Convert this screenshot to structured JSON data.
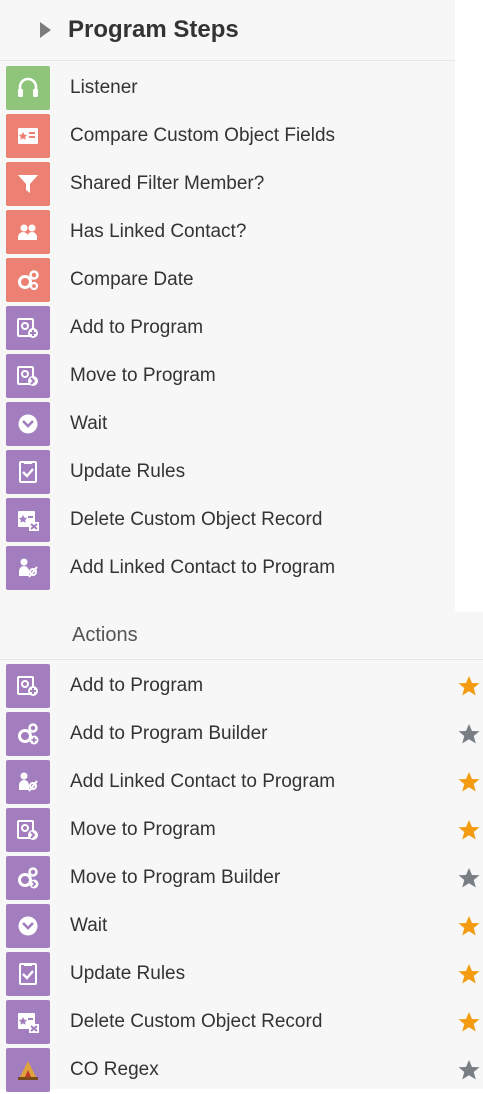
{
  "program_steps": {
    "title": "Program Steps",
    "items": [
      {
        "label": "Listener",
        "color": "#8ec57a",
        "icon": "headphones-icon"
      },
      {
        "label": "Compare Custom Object Fields",
        "color": "#ec8073",
        "icon": "custom-object-compare-icon"
      },
      {
        "label": "Shared Filter Member?",
        "color": "#ec8073",
        "icon": "filter-icon"
      },
      {
        "label": "Has Linked Contact?",
        "color": "#ec8073",
        "icon": "linked-contact-icon"
      },
      {
        "label": "Compare Date",
        "color": "#ec8073",
        "icon": "gears-icon"
      },
      {
        "label": "Add to Program",
        "color": "#a27ebe",
        "icon": "add-to-program-icon"
      },
      {
        "label": "Move to Program",
        "color": "#a27ebe",
        "icon": "move-to-program-icon"
      },
      {
        "label": "Wait",
        "color": "#a27ebe",
        "icon": "clock-icon"
      },
      {
        "label": "Update Rules",
        "color": "#a27ebe",
        "icon": "checklist-icon"
      },
      {
        "label": "Delete Custom Object Record",
        "color": "#a27ebe",
        "icon": "delete-record-icon"
      },
      {
        "label": "Add Linked Contact to Program",
        "color": "#a27ebe",
        "icon": "linked-contact-program-icon"
      }
    ]
  },
  "actions": {
    "title": "Actions",
    "items": [
      {
        "label": "Add to Program",
        "icon": "add-to-program-icon",
        "favorite": true
      },
      {
        "label": "Add to Program Builder",
        "icon": "gears-plus-icon",
        "favorite": false
      },
      {
        "label": "Add Linked Contact to Program",
        "icon": "linked-contact-program-icon",
        "favorite": true
      },
      {
        "label": "Move to Program",
        "icon": "move-to-program-icon",
        "favorite": true
      },
      {
        "label": "Move to Program Builder",
        "icon": "gears-move-icon",
        "favorite": false
      },
      {
        "label": "Wait",
        "icon": "clock-icon",
        "favorite": true
      },
      {
        "label": "Update Rules",
        "icon": "checklist-icon",
        "favorite": true
      },
      {
        "label": "Delete Custom Object Record",
        "icon": "delete-record-icon",
        "favorite": true
      },
      {
        "label": "CO Regex",
        "icon": "co-regex-icon",
        "favorite": false
      }
    ]
  },
  "colors": {
    "listener": "#8ec57a",
    "decision": "#ec8073",
    "action": "#a27ebe",
    "star_active": "#f39c12",
    "star_inactive": "#7a7f86"
  }
}
